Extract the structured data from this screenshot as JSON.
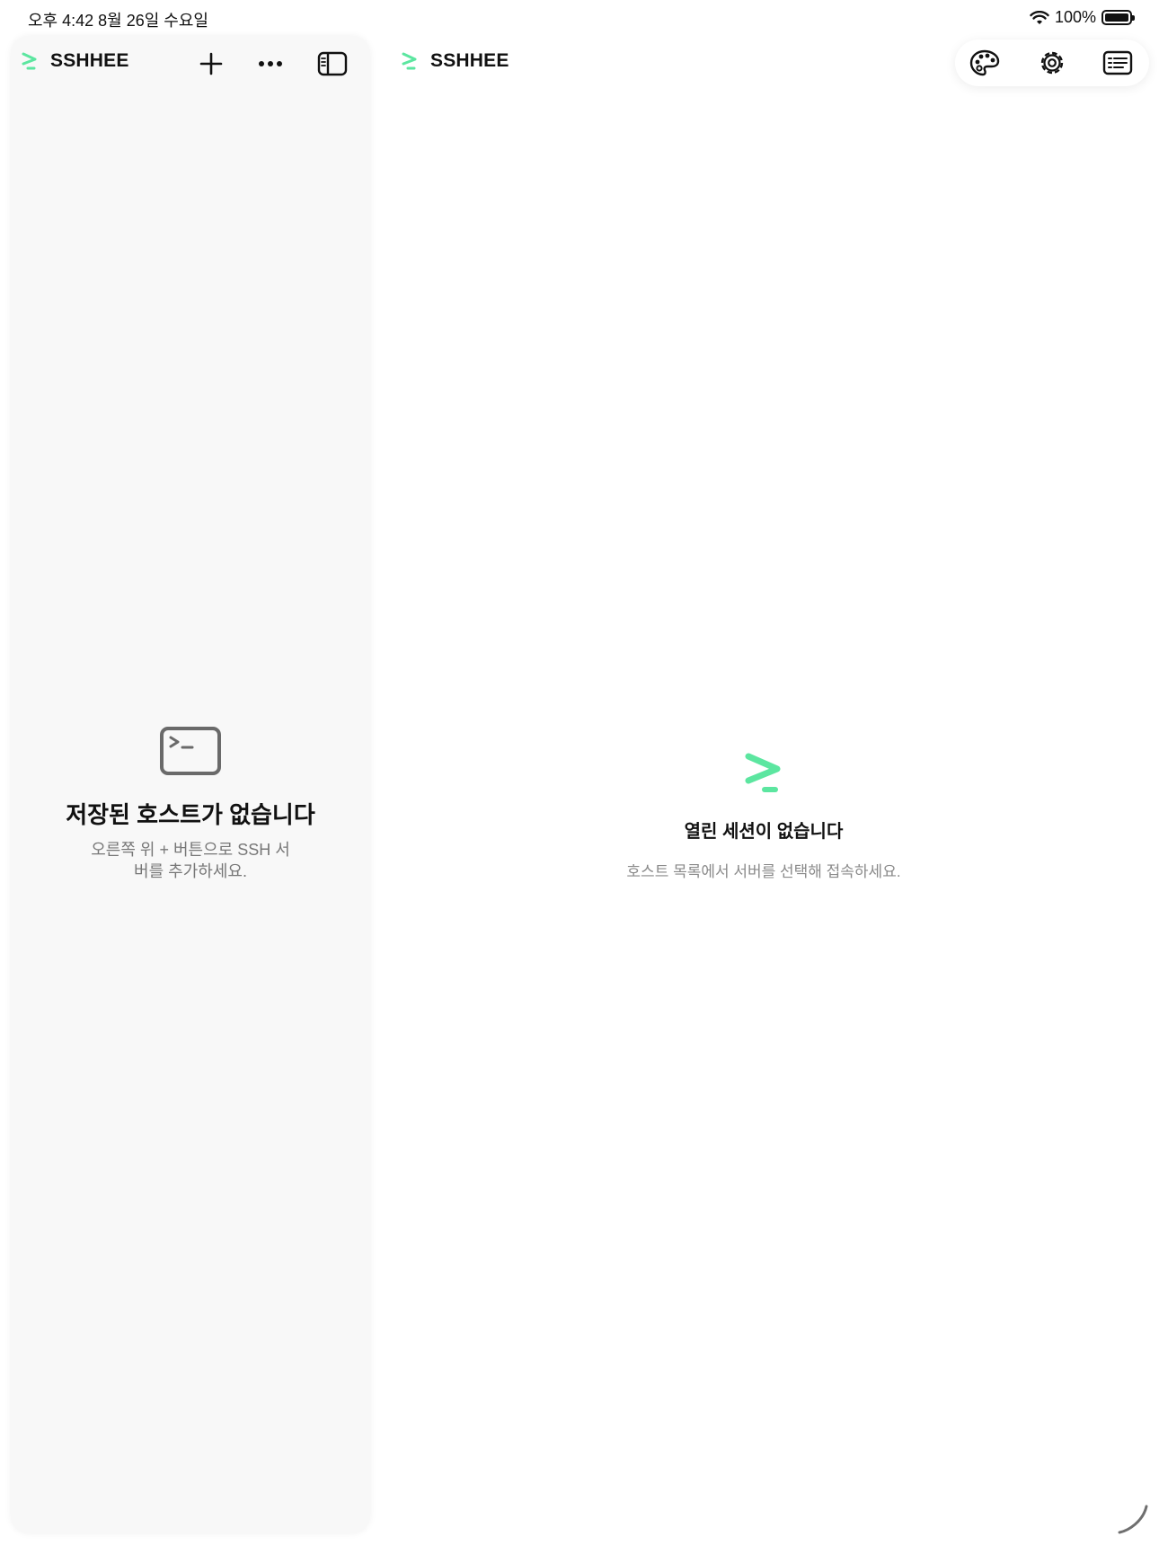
{
  "status_bar": {
    "time": "오후 4:42   8월 26일 수요일",
    "battery": "100%"
  },
  "app": {
    "name": "SSHHEE",
    "accent_color": "#5ce6a0"
  },
  "sidebar": {
    "empty_title": "저장된 호스트가 없습니다",
    "empty_subtitle": "오른쪽 위 + 버튼으로 SSH 서버를 추가하세요.",
    "icons": [
      "plus-icon",
      "ellipsis-icon",
      "sidebar-toggle-icon",
      "terminal-icon"
    ]
  },
  "main": {
    "empty_title": "열린 세션이 없습니다",
    "empty_subtitle": "호스트 목록에서 서버를 선택해 접속하세요.",
    "toolbar_icons": [
      "palette-icon",
      "gear-icon",
      "list-icon"
    ]
  }
}
